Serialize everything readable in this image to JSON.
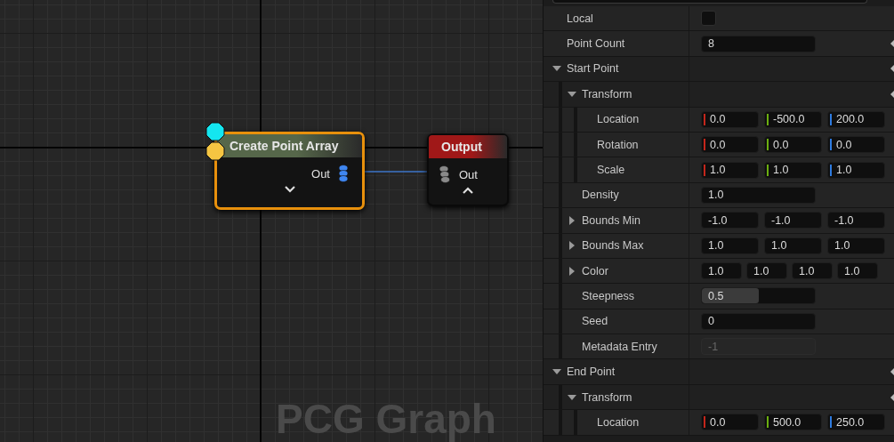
{
  "graph": {
    "title": "PCG Graph",
    "nodes": [
      {
        "title": "Create Point Array",
        "color": "#56674a",
        "selected": true,
        "expanded": false,
        "pin": {
          "kind": "output",
          "label": "Out",
          "color": "#3f86f0"
        },
        "input_pins": [
          {
            "color": "#14e6f0"
          },
          {
            "color": "#f5c542"
          }
        ]
      },
      {
        "title": "Output",
        "color": "#a01818",
        "selected": false,
        "expanded": true,
        "pin": {
          "kind": "input",
          "label": "Out",
          "color": "#8a8a8a"
        }
      }
    ]
  },
  "details": {
    "rows": [
      {
        "label": "Local",
        "kind": "checkbox",
        "checked": false,
        "reset": false
      },
      {
        "label": "Point Count",
        "kind": "number",
        "value": "8",
        "disabled": false,
        "reset": true
      },
      {
        "label": "Start Point",
        "kind": "group",
        "expanded": true,
        "reset": true,
        "children": [
          {
            "label": "Transform",
            "kind": "group",
            "expanded": true,
            "reset": true,
            "children": [
              {
                "label": "Location",
                "kind": "vector",
                "axis_colors": true,
                "values": [
                  "0.0",
                  "-500.0",
                  "200.0"
                ]
              },
              {
                "label": "Rotation",
                "kind": "vector",
                "axis_colors": true,
                "values": [
                  "0.0",
                  "0.0",
                  "0.0"
                ]
              },
              {
                "label": "Scale",
                "kind": "vector",
                "axis_colors": true,
                "values": [
                  "1.0",
                  "1.0",
                  "1.0"
                ]
              }
            ]
          },
          {
            "label": "Density",
            "kind": "number",
            "value": "1.0",
            "disabled": false
          },
          {
            "label": "Bounds Min",
            "kind": "vector",
            "expanded": false,
            "axis_colors": false,
            "values": [
              "-1.0",
              "-1.0",
              "-1.0"
            ]
          },
          {
            "label": "Bounds Max",
            "kind": "vector",
            "expanded": false,
            "axis_colors": false,
            "values": [
              "1.0",
              "1.0",
              "1.0"
            ]
          },
          {
            "label": "Color",
            "kind": "vector",
            "expanded": false,
            "axis_colors": false,
            "values": [
              "1.0",
              "1.0",
              "1.0",
              "1.0"
            ]
          },
          {
            "label": "Steepness",
            "kind": "slider",
            "value": "0.5",
            "level": 0.5
          },
          {
            "label": "Seed",
            "kind": "number",
            "value": "0",
            "disabled": false
          },
          {
            "label": "Metadata Entry",
            "kind": "number",
            "value": "-1",
            "disabled": true
          }
        ]
      },
      {
        "label": "End Point",
        "kind": "group",
        "expanded": true,
        "reset": true,
        "children": [
          {
            "label": "Transform",
            "kind": "group",
            "expanded": true,
            "reset": true,
            "children": [
              {
                "label": "Location",
                "kind": "vector",
                "axis_colors": true,
                "values": [
                  "0.0",
                  "500.0",
                  "250.0"
                ]
              }
            ]
          }
        ]
      }
    ]
  }
}
